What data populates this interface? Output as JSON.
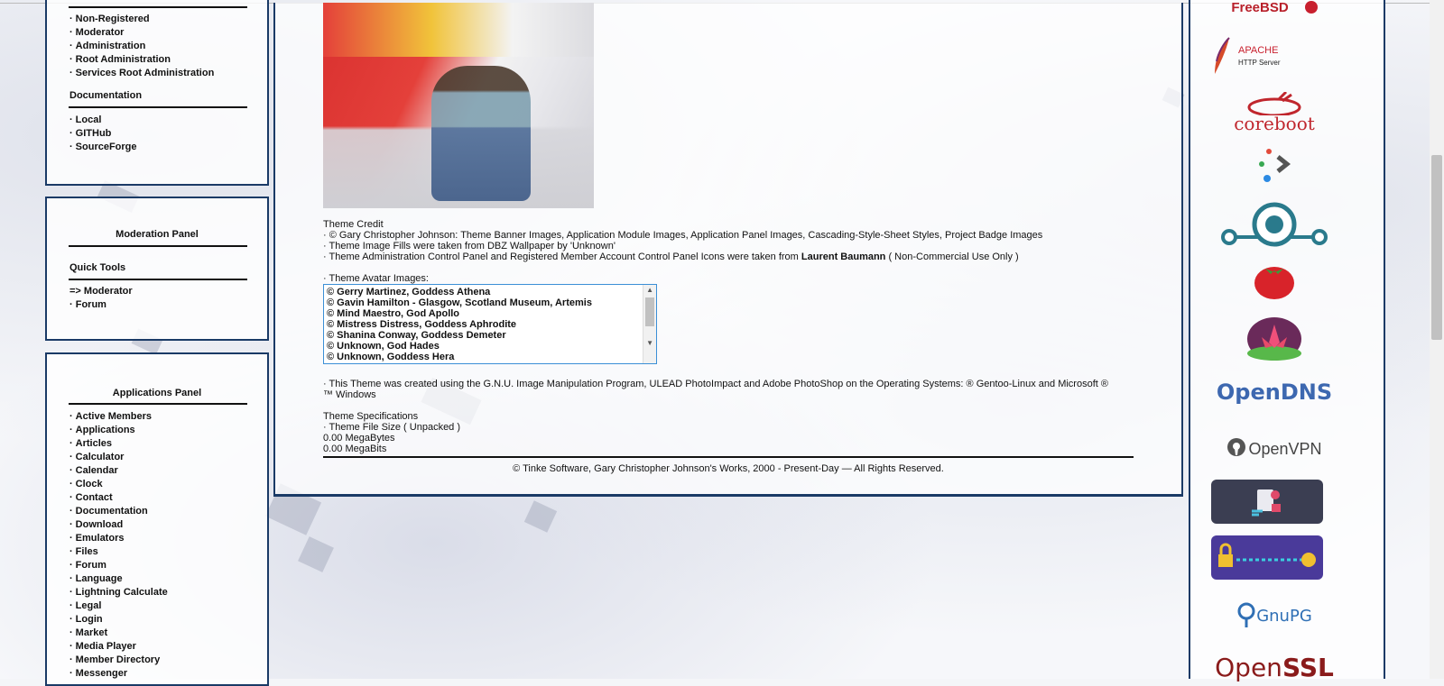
{
  "account_panel": {
    "items": [
      "Non-Registered",
      "Moderator",
      "Administration",
      "Root Administration",
      "Services Root Administration"
    ],
    "documentation_heading": "Documentation",
    "documentation_items": [
      "Local",
      "GITHub",
      "SourceForge"
    ]
  },
  "moderation_panel": {
    "title": "Moderation Panel",
    "quick_tools_heading": "Quick Tools",
    "items": [
      "=> Moderator",
      "· Forum"
    ]
  },
  "applications_panel": {
    "title": "Applications Panel",
    "items": [
      "Active Members",
      "Applications",
      "Articles",
      "Calculator",
      "Calendar",
      "Clock",
      "Contact",
      "Documentation",
      "Download",
      "Emulators",
      "Files",
      "Forum",
      "Language",
      "Lightning Calculate",
      "Legal",
      "Login",
      "Market",
      "Media Player",
      "Member Directory",
      "Messenger"
    ]
  },
  "main": {
    "theme_credit_heading": "Theme Credit",
    "credit_lines": [
      "· © Gary Christopher Johnson: Theme Banner Images, Application Module Images, Application Panel Images, Cascading-Style-Sheet Styles, Project Badge Images",
      "· Theme Image Fills were taken from DBZ Wallpaper by 'Unknown'"
    ],
    "credit_line3_prefix": "· Theme Administration Control Panel and Registered Member Account Control Panel Icons were taken from ",
    "credit_line3_name": "Laurent Baumann",
    "credit_line3_suffix": " ( Non-Commercial Use Only )",
    "avatar_label": "· Theme Avatar Images:",
    "avatar_items": [
      "© Gerry Martinez, Goddess Athena",
      "© Gavin Hamilton - Glasgow, Scotland Museum, Artemis",
      "© Mind Maestro, God Apollo",
      "© Mistress Distress, Goddess Aphrodite",
      "© Shanina Conway, Goddess Demeter",
      "© Unknown, God Hades",
      "© Unknown, Goddess Hera"
    ],
    "created_line": "· This Theme was created using the G.N.U. Image Manipulation Program, ULEAD PhotoImpact and Adobe PhotoShop on the Operating Systems: ® Gentoo-Linux and Microsoft ® ™ Windows",
    "specs_heading": "Theme Specifications",
    "file_size_label": "· Theme File Size ( Unpacked )",
    "megabytes": "0.00 MegaBytes",
    "megabits": "0.00 MegaBits",
    "footer": "© Tinke Software, Gary Christopher Johnson's Works, 2000 - Present-Day — All Rights Reserved."
  },
  "badges": {
    "freebsd": "FreeBSD",
    "apache_title": "APACHE",
    "apache_sub": "HTTP Server",
    "coreboot": "coreboot",
    "opendns": "OpenDNS",
    "openvpn": "OpenVPN",
    "gnupg": "GnuPG",
    "openssl_open": "Open",
    "openssl_ssl": "SSL"
  },
  "colors": {
    "panel_border": "#1a3a66",
    "apache_red": "#c8202e",
    "coreboot_red": "#c0262d",
    "lineage_teal": "#2a7a8c",
    "opendns_blue": "#3d68b0",
    "gnupg_blue": "#2f6fb5",
    "openssl_maroon": "#8a1b1b"
  }
}
